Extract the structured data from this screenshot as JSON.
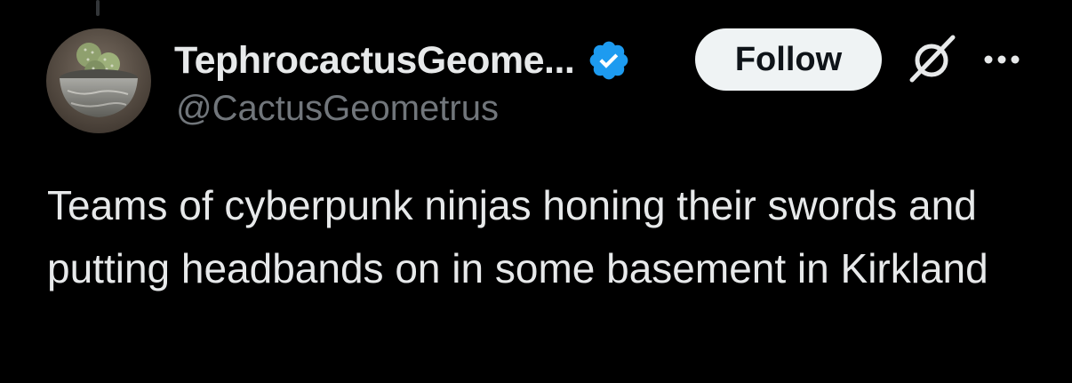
{
  "post": {
    "author": {
      "display_name": "TephrocactusGeome...",
      "handle": "@CactusGeometrus",
      "verified_icon": "verified-badge-icon",
      "verified_color": "#1d9bf0",
      "avatar": "cactus-pot-avatar"
    },
    "actions": {
      "follow_label": "Follow",
      "grok_icon": "grok-icon",
      "more_icon": "more-options-icon"
    },
    "text": "Teams of cyberpunk ninjas honing their swords and putting headbands on in some basement in Kirkland"
  },
  "theme": {
    "background": "#000000",
    "text_primary": "#e7e9ea",
    "text_secondary": "#71767b",
    "button_bg": "#eff3f4",
    "button_text": "#0f1419"
  }
}
